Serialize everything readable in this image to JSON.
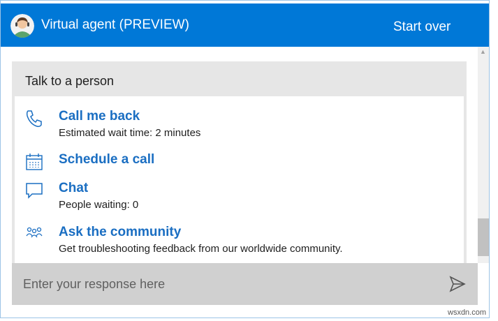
{
  "header": {
    "title": "Virtual agent (PREVIEW)",
    "start_over": "Start over",
    "color": "#0078d7"
  },
  "card": {
    "title": "Talk to a person",
    "options": [
      {
        "icon": "phone-icon",
        "label": "Call me back",
        "sub": "Estimated wait time: 2 minutes"
      },
      {
        "icon": "calendar-icon",
        "label": "Schedule a call",
        "sub": ""
      },
      {
        "icon": "chat-bubble-icon",
        "label": "Chat",
        "sub": "People waiting: 0"
      },
      {
        "icon": "community-icon",
        "label": "Ask the community",
        "sub": "Get troubleshooting feedback from our worldwide community."
      }
    ]
  },
  "input": {
    "placeholder": "Enter your response here",
    "value": ""
  },
  "watermark": "wsxdn.com"
}
